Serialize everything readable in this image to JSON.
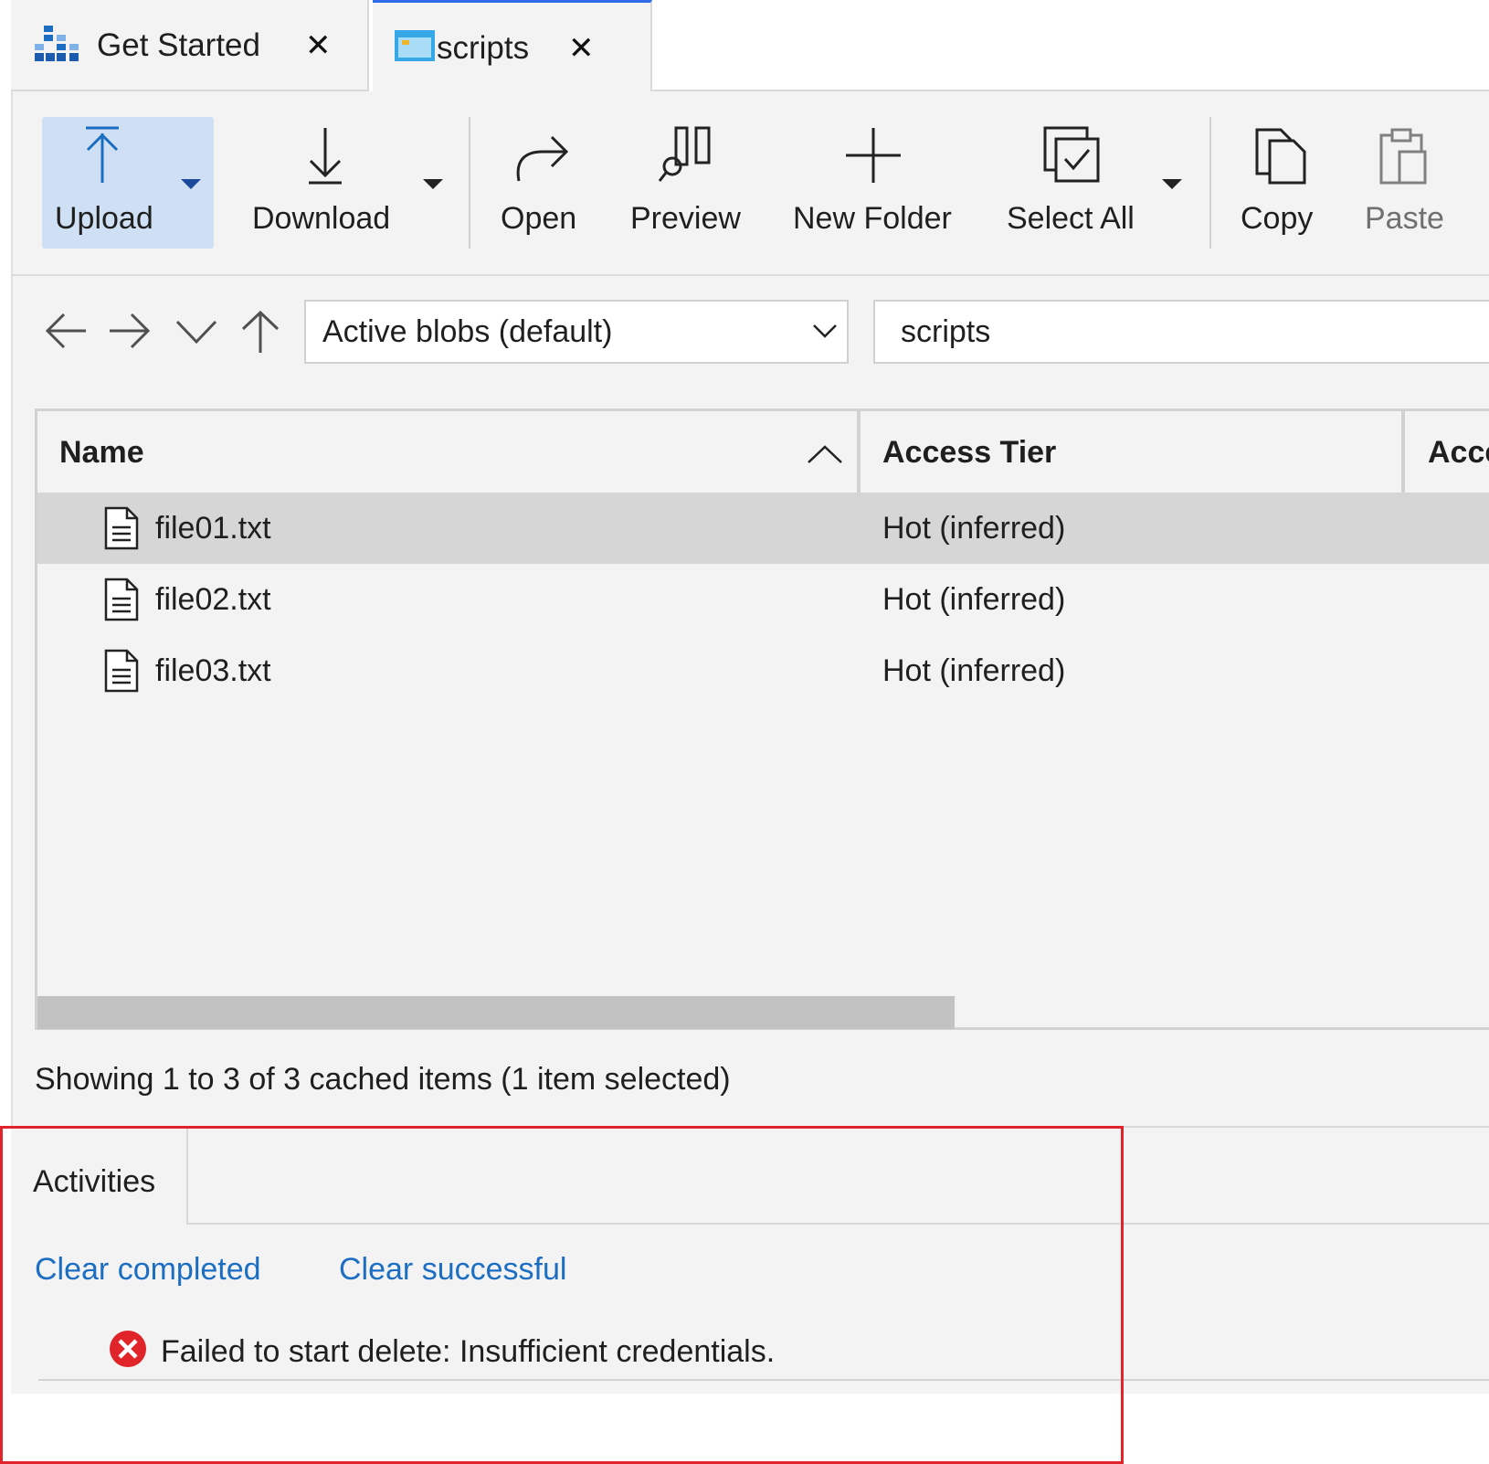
{
  "tabs": [
    {
      "label": "Get Started",
      "icon": "get-started-icon",
      "close": "✕"
    },
    {
      "label": "scripts",
      "icon": "container-icon",
      "close": "✕",
      "active": true
    }
  ],
  "toolbar": {
    "upload": "Upload",
    "download": "Download",
    "open": "Open",
    "preview": "Preview",
    "new_folder": "New Folder",
    "select_all": "Select All",
    "copy": "Copy",
    "paste": "Paste"
  },
  "nav": {
    "blob_filter": "Active blobs (default)",
    "path": "scripts"
  },
  "table": {
    "columns": [
      "Name",
      "Access Tier",
      "Acce"
    ],
    "rows": [
      {
        "name": "file01.txt",
        "tier": "Hot (inferred)",
        "selected": true
      },
      {
        "name": "file02.txt",
        "tier": "Hot (inferred)"
      },
      {
        "name": "file03.txt",
        "tier": "Hot (inferred)"
      }
    ]
  },
  "status": "Showing 1 to 3 of 3 cached items (1 item selected)",
  "activities": {
    "tab_label": "Activities",
    "clear_completed": "Clear completed",
    "clear_successful": "Clear successful",
    "message": "Failed to start delete: Insufficient credentials."
  },
  "colors": {
    "accent": "#1b6ec2",
    "upload_highlight": "#cfe0f5",
    "error": "#e0242a",
    "active_tab_border": "#2e6be6"
  }
}
